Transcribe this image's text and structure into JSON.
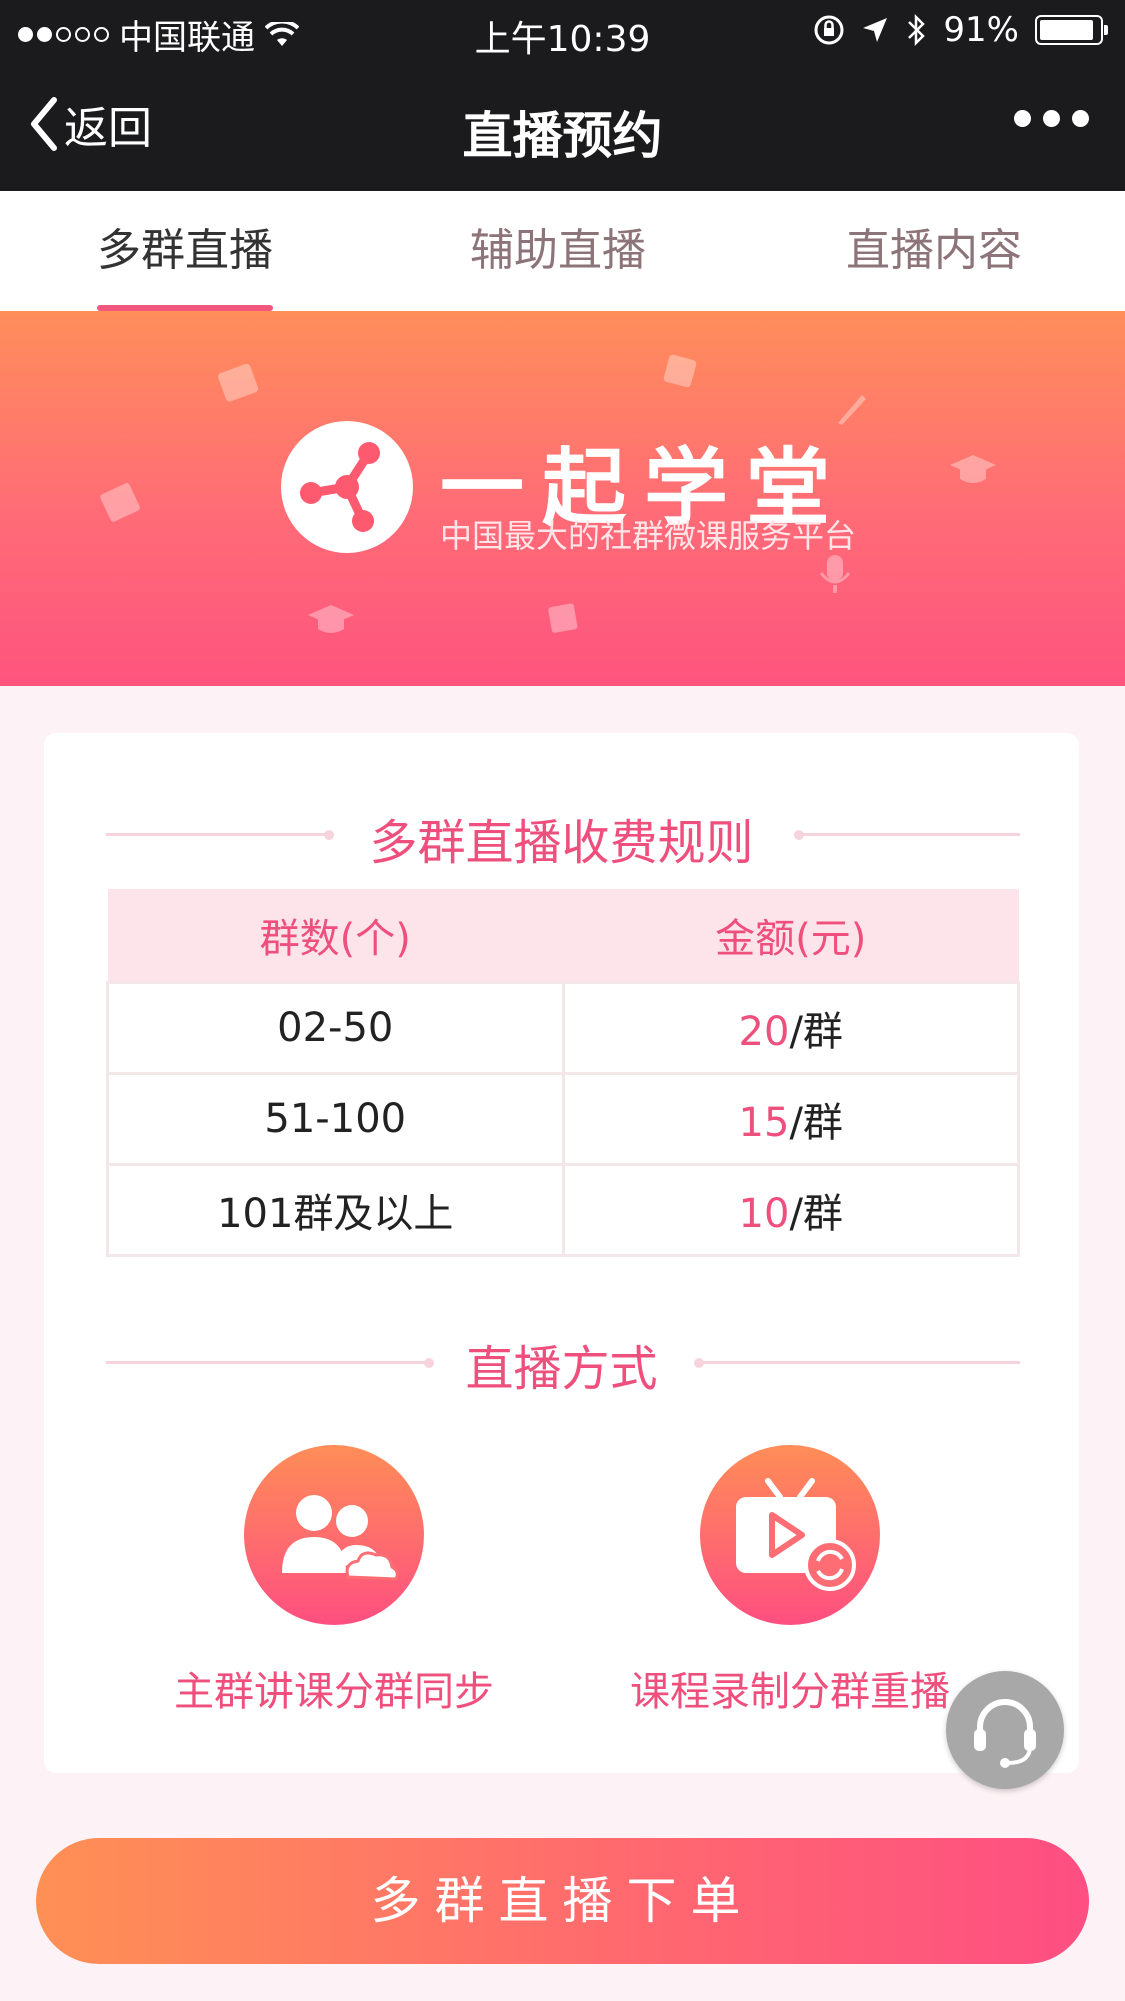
{
  "status_bar": {
    "carrier": "中国联通",
    "time": "上午10:39",
    "battery": "91%",
    "battery_level": 0.91
  },
  "nav": {
    "back_label": "返回",
    "title": "直播预约"
  },
  "tabs": [
    {
      "label": "多群直播",
      "active": true
    },
    {
      "label": "辅助直播",
      "active": false
    },
    {
      "label": "直播内容",
      "active": false
    }
  ],
  "banner": {
    "brand": "一起学堂",
    "slogan": "中国最大的社群微课服务平台"
  },
  "fee_section": {
    "title": "多群直播收费规则",
    "headers": [
      "群数(个)",
      "金额(元)"
    ],
    "rows": [
      {
        "count": "02-50",
        "amount": "20",
        "unit": "/群"
      },
      {
        "count": "51-100",
        "amount": "15",
        "unit": "/群"
      },
      {
        "count": "101群及以上",
        "amount": "10",
        "unit": "/群"
      }
    ]
  },
  "mode_section": {
    "title": "直播方式",
    "modes": [
      {
        "label": "主群讲课分群同步",
        "icon": "group-users-icon"
      },
      {
        "label": "课程录制分群重播",
        "icon": "tv-replay-icon"
      }
    ]
  },
  "order_button": "多群直播下单",
  "colors": {
    "accent": "#ee4f7c",
    "gradient_start": "#ff9055",
    "gradient_end": "#fe4e82"
  }
}
